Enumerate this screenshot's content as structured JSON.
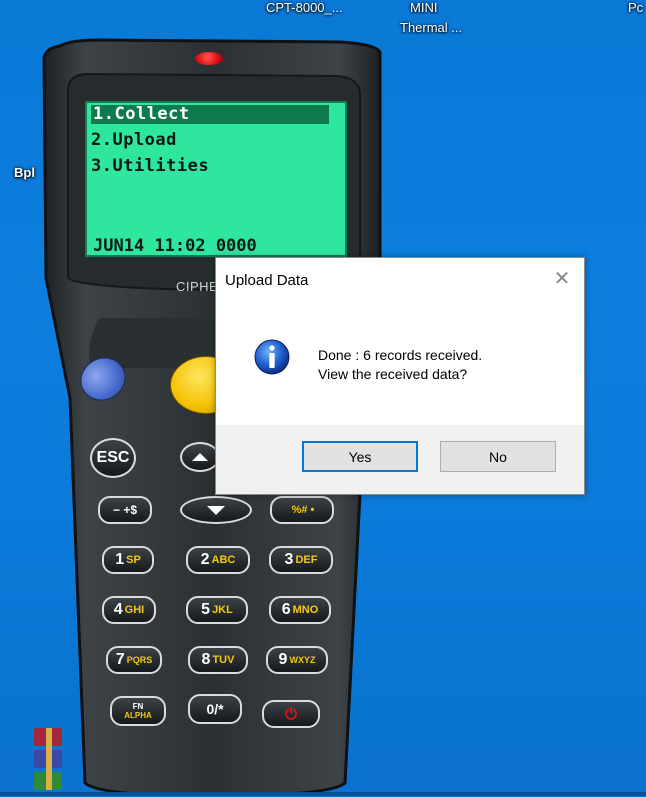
{
  "desktop": {
    "labels": {
      "cpt": "CPT-8000_...",
      "mini_line1": "MINI",
      "mini_line2": "Thermal ...",
      "right_partial": "Pc",
      "left_partial": "Bpl"
    }
  },
  "device": {
    "menu": [
      "1.Collect",
      "2.Upload",
      "3.Utilities"
    ],
    "status_line": "JUN14 11:02 0000",
    "brand": "CIPHEF",
    "keys": {
      "esc": "ESC",
      "minus": "− +$",
      "percent": "%# •",
      "k1": {
        "num": "1",
        "sub": "SP"
      },
      "k2": {
        "num": "2",
        "sub": "ABC"
      },
      "k3": {
        "num": "3",
        "sub": "DEF"
      },
      "k4": {
        "num": "4",
        "sub": "GHI"
      },
      "k5": {
        "num": "5",
        "sub": "JKL"
      },
      "k6": {
        "num": "6",
        "sub": "MNO"
      },
      "k7": {
        "num": "7",
        "sub": "PQRS"
      },
      "k8": {
        "num": "8",
        "sub": "TUV"
      },
      "k9": {
        "num": "9",
        "sub": "WXYZ"
      },
      "fn_top": "FN",
      "fn_bottom": "ALPHA",
      "zero": "0/*",
      "power": "⏻"
    },
    "colors": {
      "lcd": "#2ee6a0",
      "accent_blue": "#4a6fd0",
      "accent_yellow": "#f5c000"
    }
  },
  "dialog": {
    "title": "Upload Data",
    "close_icon": "close-icon",
    "icon": "info-icon",
    "message_line1": "Done : 6 records received.",
    "message_line2": "View the received data?",
    "yes_label": "Yes",
    "no_label": "No"
  }
}
